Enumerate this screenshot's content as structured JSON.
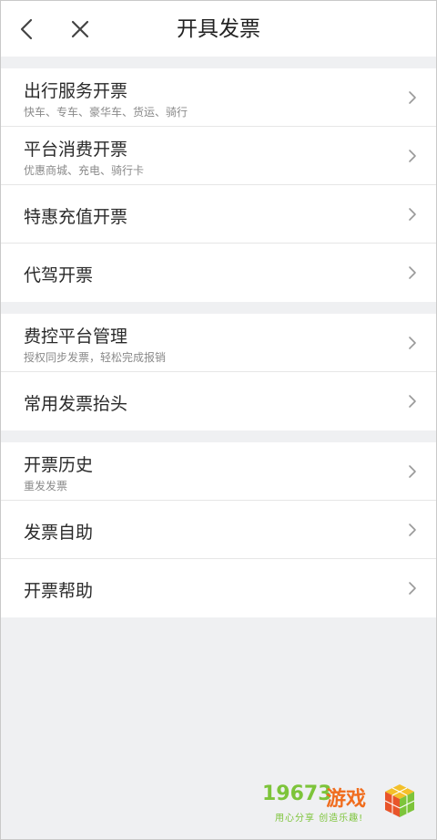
{
  "header": {
    "title": "开具发票"
  },
  "sections": [
    {
      "items": [
        {
          "label": "出行服务开票",
          "sub": "快车、专车、豪华车、货运、骑行"
        },
        {
          "label": "平台消费开票",
          "sub": "优惠商城、充电、骑行卡"
        },
        {
          "label": "特惠充值开票",
          "sub": ""
        },
        {
          "label": "代驾开票",
          "sub": ""
        }
      ]
    },
    {
      "items": [
        {
          "label": "费控平台管理",
          "sub": "授权同步发票，轻松完成报销"
        },
        {
          "label": "常用发票抬头",
          "sub": ""
        }
      ]
    },
    {
      "items": [
        {
          "label": "开票历史",
          "sub": "重发发票"
        },
        {
          "label": "发票自助",
          "sub": ""
        },
        {
          "label": "开票帮助",
          "sub": ""
        }
      ]
    }
  ],
  "watermark": {
    "number": "19673",
    "name": "游戏",
    "slogan": "用心分享 创造乐趣!"
  },
  "colors": {
    "background": "#eff0f2",
    "watermark_green": "#7dc43a",
    "watermark_orange": "#f06d1e"
  }
}
